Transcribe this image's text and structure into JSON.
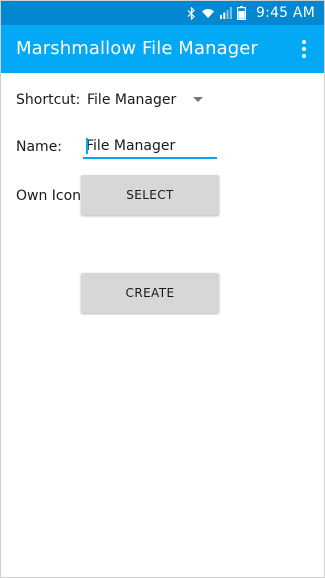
{
  "status_bar": {
    "time": "9:45 AM",
    "icons": [
      "bluetooth-icon",
      "wifi-icon",
      "signal-icon",
      "battery-icon"
    ],
    "battery_level": "70%"
  },
  "app_bar": {
    "title": "Marshmallow File Manager",
    "menu_icon": "more-vert-icon"
  },
  "form": {
    "shortcut_label": "Shortcut:",
    "shortcut_value": "File Manager",
    "name_label": "Name:",
    "name_value": "File Manager",
    "icon_label": "Own Icon:",
    "select_label": "SELECT",
    "create_label": "CREATE"
  },
  "colors": {
    "status_bar": "#0288d1",
    "app_bar": "#03a9f4",
    "accent": "#03a9f4",
    "button": "#d6d7d7"
  }
}
